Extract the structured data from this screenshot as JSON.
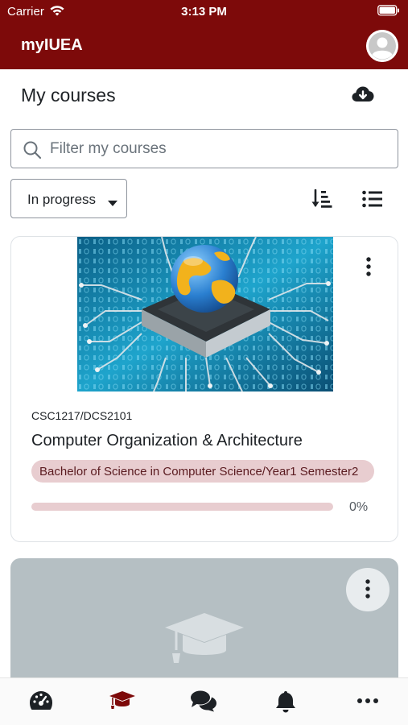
{
  "status_bar": {
    "carrier": "Carrier",
    "time": "3:13 PM"
  },
  "header": {
    "app_title": "myIUEA"
  },
  "page": {
    "title": "My courses"
  },
  "search": {
    "placeholder": "Filter my courses",
    "value": ""
  },
  "filter": {
    "selected": "In progress"
  },
  "courses": [
    {
      "code": "CSC1217/DCS2101",
      "name": "Computer Organization & Architecture",
      "category": "Bachelor of Science in Computer Science/Year1 Semester2",
      "progress_percent": 0,
      "progress_label": "0%"
    }
  ],
  "tabs": [
    {
      "icon": "dashboard-icon",
      "active": false
    },
    {
      "icon": "graduation-cap-icon",
      "active": true
    },
    {
      "icon": "messages-icon",
      "active": false
    },
    {
      "icon": "bell-icon",
      "active": false
    },
    {
      "icon": "more-icon",
      "active": false
    }
  ],
  "colors": {
    "brand": "#7d0a0a",
    "badge_bg": "#e8cdd0",
    "placeholder_card": "#b5bfc3"
  }
}
